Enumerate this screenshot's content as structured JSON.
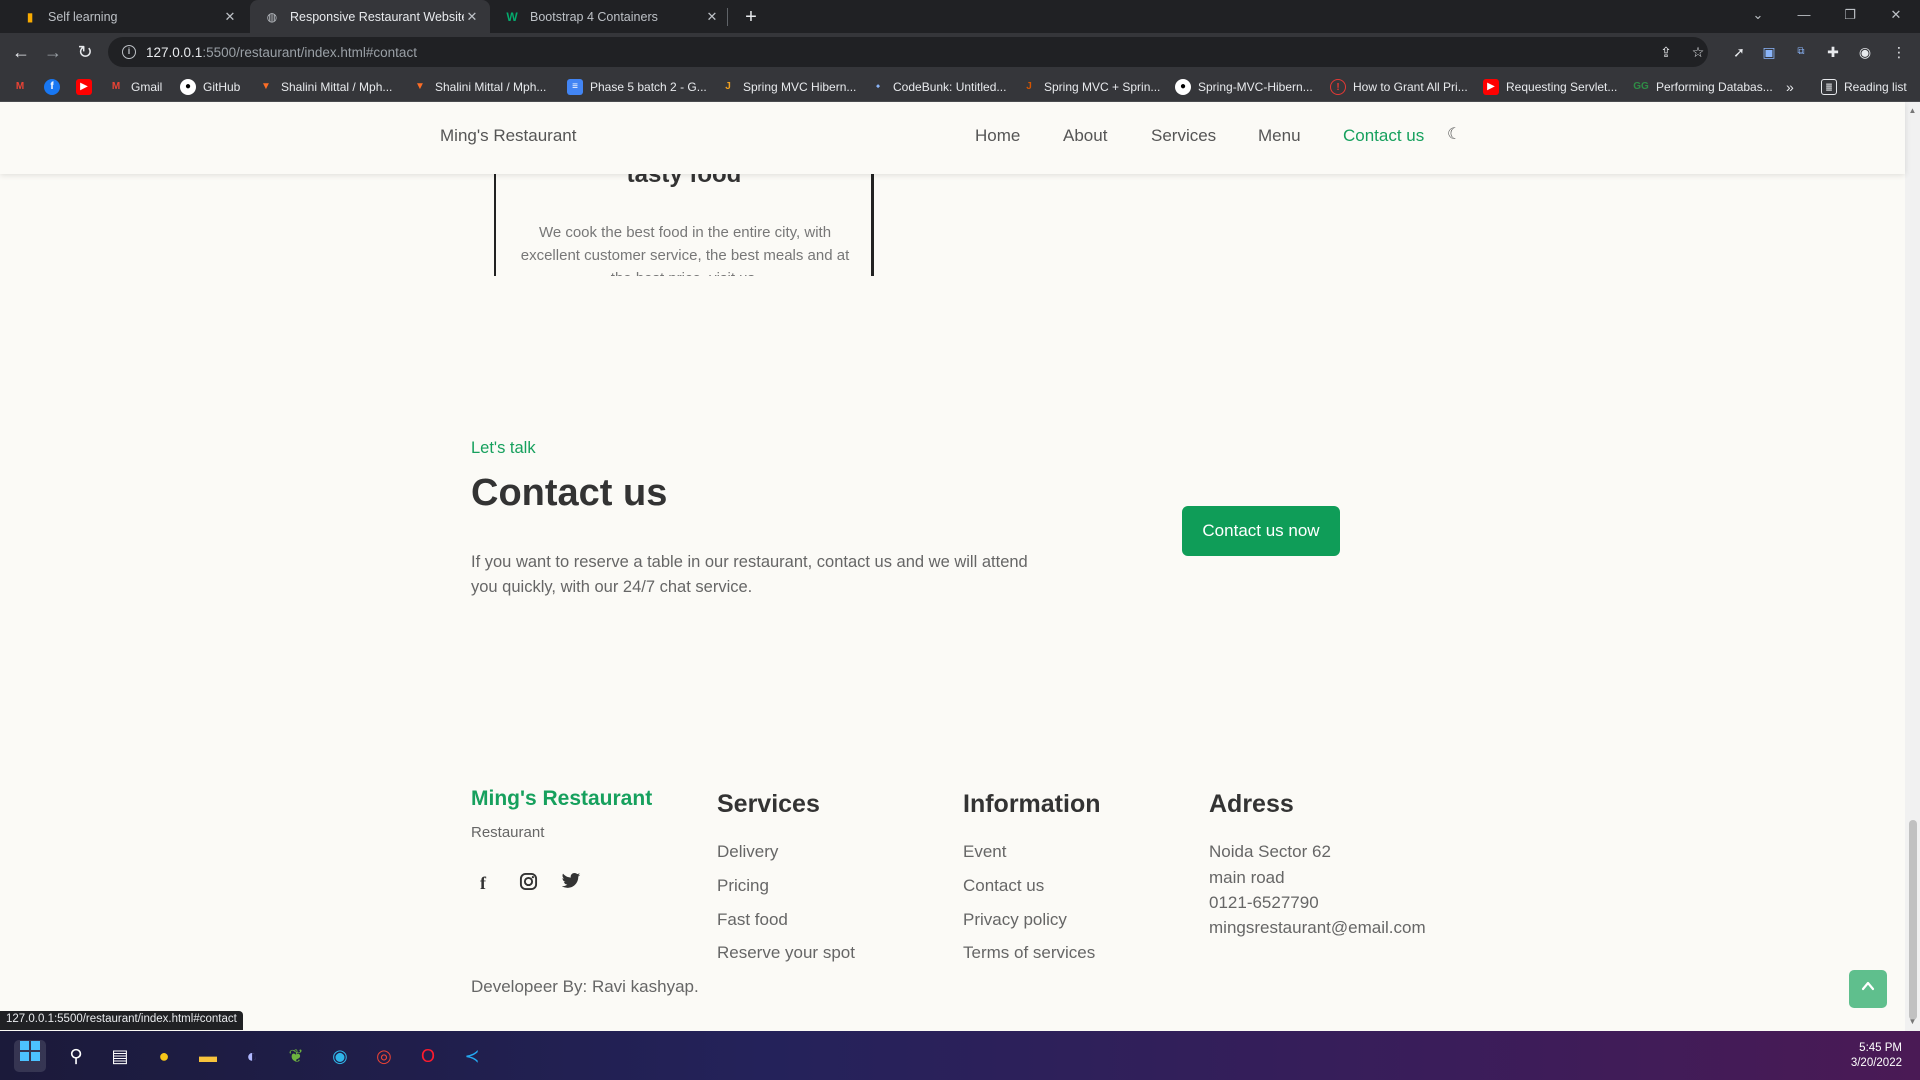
{
  "browser": {
    "tabs": [
      {
        "label": "Self learning",
        "icon": "analytics-icon"
      },
      {
        "label": "Responsive Restaurant Website",
        "icon": "globe-icon"
      },
      {
        "label": "Bootstrap 4 Containers",
        "icon": "w3schools-icon"
      }
    ],
    "url_host": "127.0.0.1",
    "url_path": ":5500/restaurant/index.html#contact",
    "bookmarks": [
      {
        "label": "",
        "icon": "gmail-icon",
        "color": "#ea4335"
      },
      {
        "label": "",
        "icon": "facebook-icon",
        "color": "#1877f2"
      },
      {
        "label": "",
        "icon": "youtube-icon",
        "color": "#ff0000"
      },
      {
        "label": "Gmail",
        "icon": "gmail-icon",
        "color": "#ea4335"
      },
      {
        "label": "GitHub",
        "icon": "github-icon",
        "color": "#ffffff"
      },
      {
        "label": "Shalini Mittal / Mph...",
        "icon": "gitlab-icon",
        "color": "#fc6d26"
      },
      {
        "label": "Shalini Mittal / Mph...",
        "icon": "gitlab-icon",
        "color": "#fc6d26"
      },
      {
        "label": "Phase 5 batch 2 - G...",
        "icon": "docs-icon",
        "color": "#4285f4"
      },
      {
        "label": "Spring MVC Hibern...",
        "icon": "java-icon",
        "color": "#f0a020"
      },
      {
        "label": "CodeBunk: Untitled...",
        "icon": "codebunk-icon",
        "color": "#3b5998"
      },
      {
        "label": "Spring MVC + Sprin...",
        "icon": "spring-icon",
        "color": "#d35400"
      },
      {
        "label": "Spring-MVC-Hibern...",
        "icon": "github-icon",
        "color": "#ffffff"
      },
      {
        "label": "How to Grant All Pri...",
        "icon": "info-icon",
        "color": "#e53935"
      },
      {
        "label": "Requesting Servlet...",
        "icon": "youtube-icon",
        "color": "#ff0000"
      },
      {
        "label": "Performing Databas...",
        "icon": "geeks-icon",
        "color": "#2f8d46"
      }
    ],
    "overflow": "»",
    "reading_list": "Reading list",
    "status_url": "127.0.0.1:5500/restaurant/index.html#contact"
  },
  "site": {
    "brand": "Ming's Restaurant",
    "nav": [
      "Home",
      "About",
      "Services",
      "Menu",
      "Contact us"
    ],
    "active_nav": "Contact us",
    "card": {
      "title": "tasty food",
      "text": "We cook the best food in the entire city, with excellent customer service, the best meals and at the best price, visit us."
    },
    "contact": {
      "subtitle": "Let's talk",
      "title": "Contact us",
      "description": "If you want to reserve a table in our restaurant, contact us and we will attend you quickly, with our 24/7 chat service.",
      "button": "Contact us now"
    },
    "footer": {
      "brand": "Ming's Restaurant",
      "tagline": "Restaurant",
      "social": [
        "facebook-icon",
        "instagram-icon",
        "twitter-icon"
      ],
      "services": {
        "title": "Services",
        "links": [
          "Delivery",
          "Pricing",
          "Fast food",
          "Reserve your spot"
        ]
      },
      "information": {
        "title": "Information",
        "links": [
          "Event",
          "Contact us",
          "Privacy policy",
          "Terms of services"
        ]
      },
      "address": {
        "title": "Adress",
        "lines": [
          "Noida Sector 62",
          "main road",
          "0121-6527790",
          "mingsrestaurant@email.com"
        ]
      },
      "developer": "Developeer By: Ravi kashyap."
    },
    "accent_color": "#16a05d"
  },
  "taskbar": {
    "time": "5:45 PM",
    "date": "3/20/2022"
  }
}
